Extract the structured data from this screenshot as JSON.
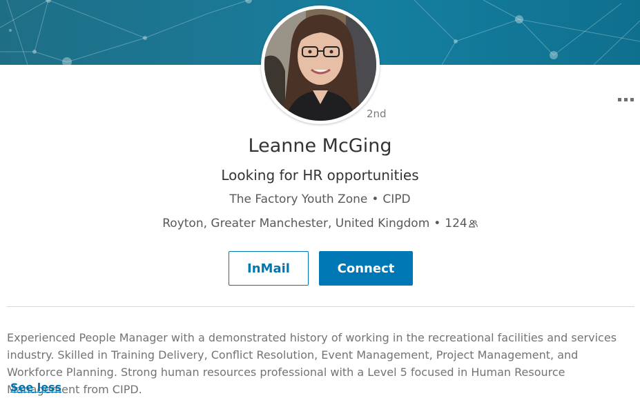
{
  "profile": {
    "degree": "2nd",
    "name": "Leanne McGing",
    "headline": "Looking for HR opportunities",
    "company": "The Factory Youth Zone",
    "education": "CIPD",
    "location": "Royton, Greater Manchester, United Kingdom",
    "connections": "124",
    "separator": "•"
  },
  "actions": {
    "inmail_label": "InMail",
    "connect_label": "Connect"
  },
  "summary": {
    "text": "Experienced People Manager with a demonstrated history of working in the recreational facilities and services industry. Skilled in Training Delivery, Conflict Resolution, Event Management, Project Management, and Workforce Planning. Strong human resources professional with a Level 5 focused in Human Resource Management from CIPD.",
    "see_less_label": "See less"
  },
  "icons": {
    "more": "more-options-icon",
    "connections": "connections-icon"
  },
  "colors": {
    "accent": "#0077b5",
    "banner": "#1b7895",
    "text_primary": "#333333",
    "text_secondary": "#595959"
  }
}
